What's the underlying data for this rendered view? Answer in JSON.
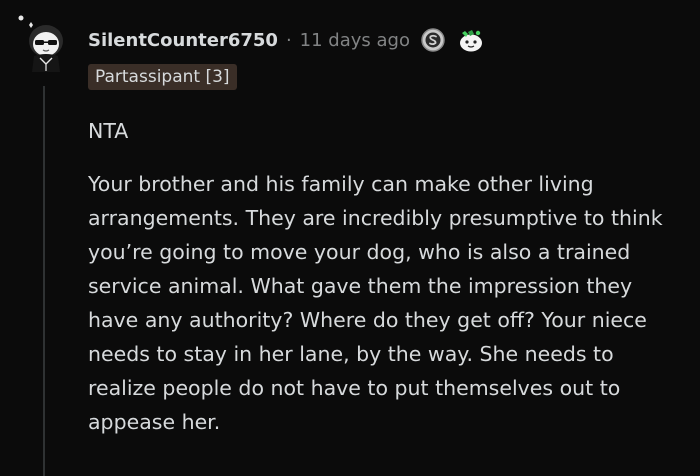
{
  "comment": {
    "username": "SilentCounter6750",
    "separator": "·",
    "timestamp": "11 days ago",
    "flair": "Partassipant [3]",
    "awards": [
      {
        "name": "silver-award-icon"
      },
      {
        "name": "wholesome-award-icon"
      }
    ],
    "body": {
      "verdict": "NTA",
      "paragraph": "Your brother and his family can make other living arrangements. They are incredibly presumptive to think you’re going to move your dog, who is also a trained service animal. What gave them the impression they have any authority? Where do they get off? Your niece needs to stay in her lane, by the way. She needs to realize people do not have to put themselves out to appease her."
    }
  },
  "colors": {
    "background": "#0b0b0b",
    "text": "#d7dadc",
    "meta": "#818384",
    "flair_bg": "#3a2e27",
    "thread_line": "#2f3233"
  }
}
